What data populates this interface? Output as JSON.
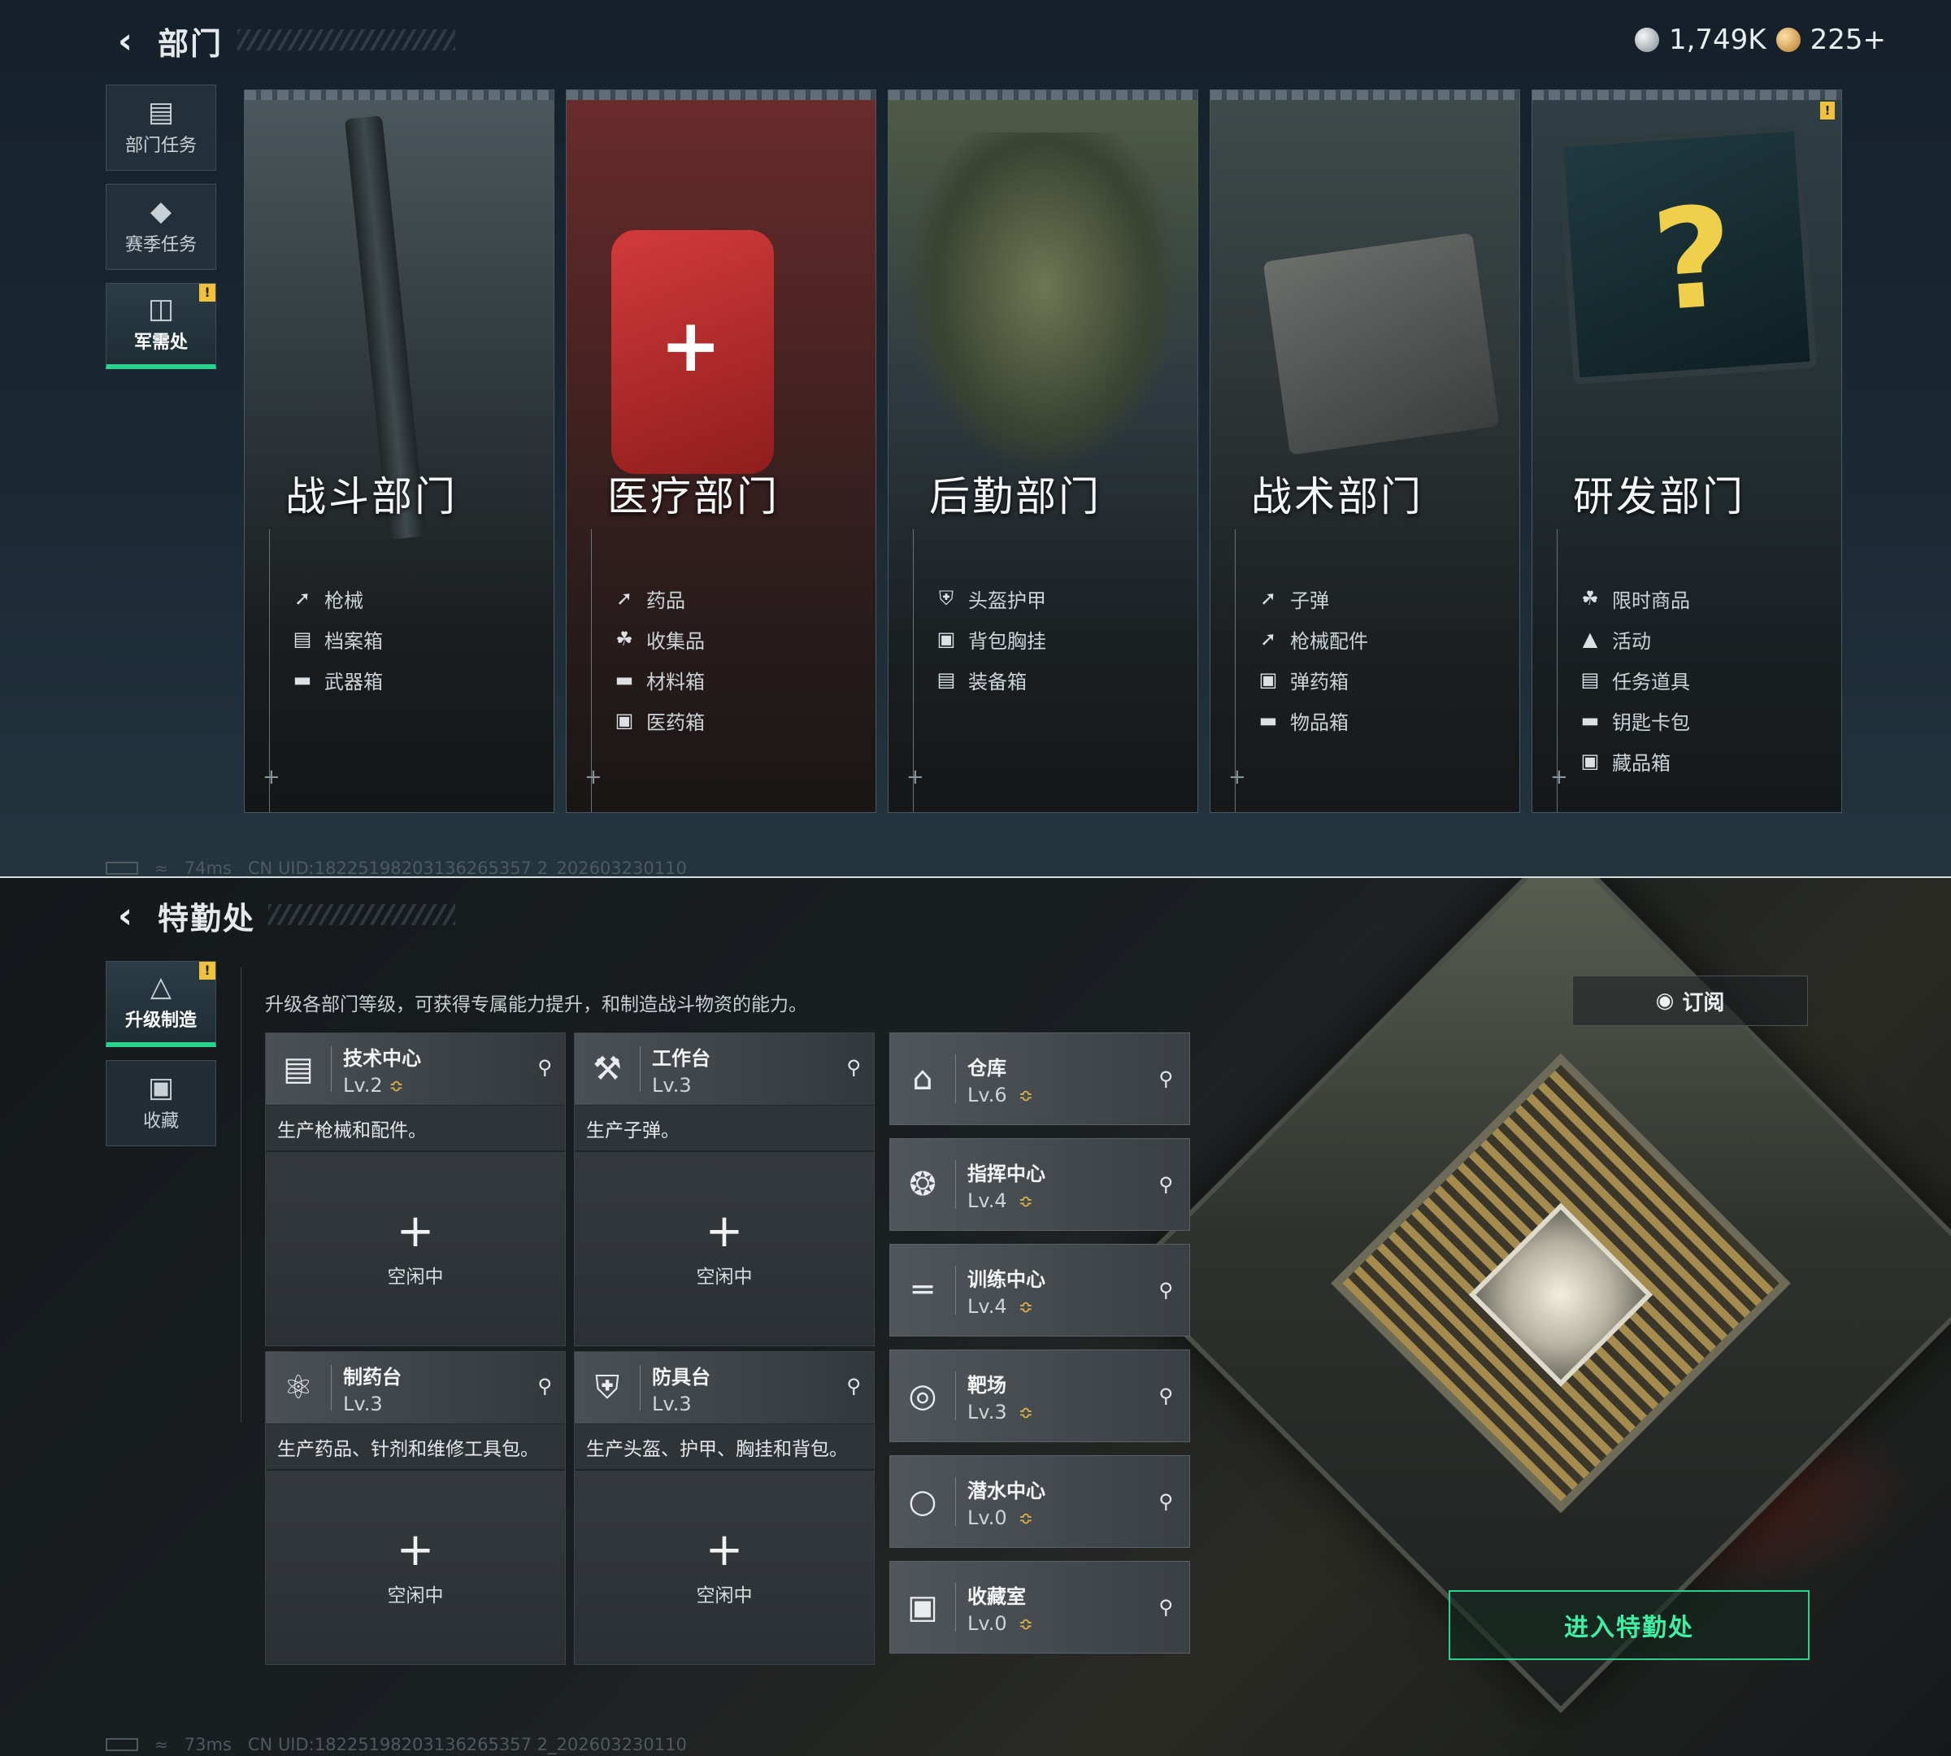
{
  "top": {
    "title": "部门",
    "currency": {
      "silver": "1,749K",
      "gold": "225+"
    },
    "sidebar": [
      {
        "label": "部门任务",
        "icon": "clipboard-icon",
        "active": false,
        "badge": false
      },
      {
        "label": "赛季任务",
        "icon": "season-icon",
        "active": false,
        "badge": false
      },
      {
        "label": "军需处",
        "icon": "coins-icon",
        "active": true,
        "badge": true
      }
    ],
    "badge_mark": "!",
    "cards": [
      {
        "name": "战斗部门",
        "items": [
          "枪械",
          "档案箱",
          "武器箱"
        ]
      },
      {
        "name": "医疗部门",
        "items": [
          "药品",
          "收集品",
          "材料箱",
          "医药箱"
        ]
      },
      {
        "name": "后勤部门",
        "items": [
          "头盔护甲",
          "背包胸挂",
          "装备箱"
        ]
      },
      {
        "name": "战术部门",
        "items": [
          "子弹",
          "枪械配件",
          "弹药箱",
          "物品箱"
        ]
      },
      {
        "name": "研发部门",
        "items": [
          "限时商品",
          "活动",
          "任务道具",
          "钥匙卡包",
          "藏品箱"
        ],
        "warn": true
      }
    ],
    "status": {
      "ping": "74ms",
      "uid": "CN UID:18225198203136265357 2_202603230110"
    }
  },
  "bottom": {
    "title": "特勤处",
    "sidebar": [
      {
        "label": "升级制造",
        "icon": "upgrade-icon",
        "active": true,
        "badge": true
      },
      {
        "label": "收藏",
        "icon": "collection-icon",
        "active": false,
        "badge": false
      }
    ],
    "subtitle": "升级各部门等级，可获得专属能力提升，和制造战斗物资的能力。",
    "facilities": [
      {
        "name": "技术中心",
        "level": "Lv.2",
        "desc": "生产枪械和配件。",
        "idle": "空闲中",
        "upgradable": true,
        "icon": "monitor-icon"
      },
      {
        "name": "工作台",
        "level": "Lv.3",
        "desc": "生产子弹。",
        "idle": "空闲中",
        "upgradable": false,
        "icon": "tools-icon"
      },
      {
        "name": "制药台",
        "level": "Lv.3",
        "desc": "生产药品、针剂和维修工具包。",
        "idle": "空闲中",
        "upgradable": false,
        "icon": "microscope-icon"
      },
      {
        "name": "防具台",
        "level": "Lv.3",
        "desc": "生产头盔、护甲、胸挂和背包。",
        "idle": "空闲中",
        "upgradable": false,
        "icon": "armor-icon"
      }
    ],
    "rooms": [
      {
        "name": "仓库",
        "level": "Lv.6",
        "icon": "warehouse-icon"
      },
      {
        "name": "指挥中心",
        "level": "Lv.4",
        "icon": "command-icon"
      },
      {
        "name": "训练中心",
        "level": "Lv.4",
        "icon": "dumbbell-icon"
      },
      {
        "name": "靶场",
        "level": "Lv.3",
        "icon": "target-icon"
      },
      {
        "name": "潜水中心",
        "level": "Lv.0",
        "icon": "diving-mask-icon"
      },
      {
        "name": "收藏室",
        "level": "Lv.0",
        "icon": "collection-room-icon"
      }
    ],
    "subscribe_label": "订阅",
    "enter_label": "进入特勤处",
    "status": {
      "ping": "73ms",
      "uid": "CN UID:18225198203136265357 2_202603230110"
    }
  },
  "symbols": {
    "plus": "+",
    "back": "<",
    "search": "⚲",
    "up": "≎"
  }
}
